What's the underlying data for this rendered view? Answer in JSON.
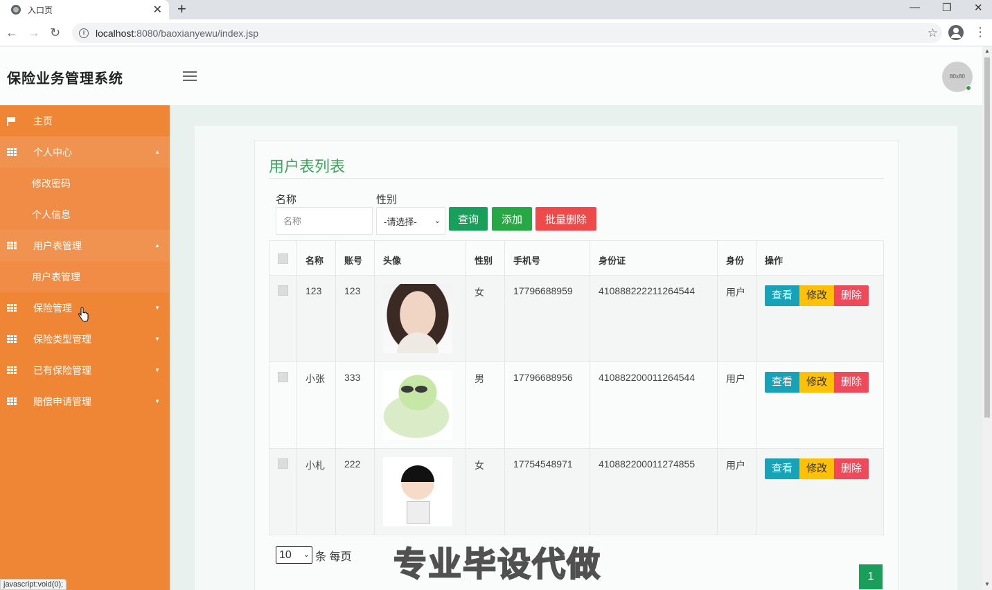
{
  "browser": {
    "tab_title": "入口页",
    "url_host": "localhost",
    "url_path": ":8080/baoxianyewu/index.jsp",
    "status_text": "javascript:void(0);"
  },
  "header": {
    "title": "保险业务管理系统",
    "avatar_text": "80x80"
  },
  "sidebar": {
    "items": [
      {
        "label": "主页",
        "icon": "flag-icon"
      },
      {
        "label": "个人中心",
        "icon": "grid-icon",
        "expanded": true
      },
      {
        "label": "修改密码",
        "sub": true
      },
      {
        "label": "个人信息",
        "sub": true
      },
      {
        "label": "用户表管理",
        "icon": "grid-icon",
        "expanded": true
      },
      {
        "label": "用户表管理",
        "sub": true
      },
      {
        "label": "保险管理",
        "icon": "grid-icon"
      },
      {
        "label": "保险类型管理",
        "icon": "grid-icon"
      },
      {
        "label": "已有保险管理",
        "icon": "grid-icon"
      },
      {
        "label": "赔偿申请管理",
        "icon": "grid-icon"
      }
    ]
  },
  "page": {
    "title": "用户表列表",
    "filters": {
      "name_label": "名称",
      "name_placeholder": "名称",
      "sex_label": "性别",
      "sex_selected": "-请选择-"
    },
    "buttons": {
      "query": "查询",
      "add": "添加",
      "batch_delete": "批量删除"
    },
    "table": {
      "columns": [
        "名称",
        "账号",
        "头像",
        "性别",
        "手机号",
        "身份证",
        "身份",
        "操作"
      ],
      "rows": [
        {
          "name": "123",
          "account": "123",
          "sex": "女",
          "phone": "17796688959",
          "id_card": "410888222211264544",
          "role": "用户"
        },
        {
          "name": "小张",
          "account": "333",
          "sex": "男",
          "phone": "17796688956",
          "id_card": "410882200011264544",
          "role": "用户"
        },
        {
          "name": "小札",
          "account": "222",
          "sex": "女",
          "phone": "17754548971",
          "id_card": "410882200011274855",
          "role": "用户"
        }
      ],
      "actions": {
        "view": "查看",
        "edit": "修改",
        "delete": "删除"
      }
    },
    "pager": {
      "page_size": "10",
      "suffix": "条 每页",
      "current_page": "1"
    },
    "watermark": "专业毕设代做"
  }
}
